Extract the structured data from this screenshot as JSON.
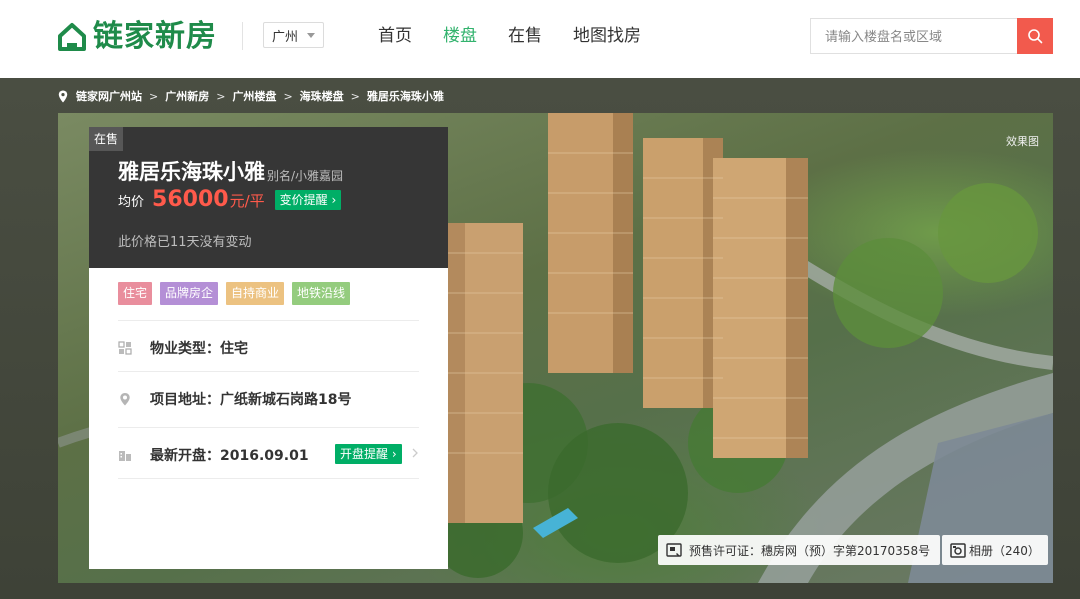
{
  "header": {
    "logo_text": "链家新房",
    "city": "广州",
    "nav": [
      {
        "label": "首页",
        "active": false
      },
      {
        "label": "楼盘",
        "active": true
      },
      {
        "label": "在售",
        "active": false
      },
      {
        "label": "地图找房",
        "active": false
      }
    ],
    "search": {
      "placeholder": "请输入楼盘名或区域",
      "value": ""
    },
    "accent": "#33b36e"
  },
  "breadcrumb": [
    "链家网广州站",
    "广州新房",
    "广州楼盘",
    "海珠楼盘",
    "雅居乐海珠小雅"
  ],
  "hero": {
    "effect_label": "效果图",
    "license": "预售许可证：穗房网（预）字第20170358号",
    "album": "相册（240）"
  },
  "project": {
    "status": "在售",
    "name": "雅居乐海珠小雅",
    "alias": "别名/小雅嘉园",
    "price_label": "均价",
    "price": "56000",
    "price_unit": "元/平",
    "price_alert": "变价提醒",
    "price_note": "此价格已11天没有变动",
    "tags": [
      "住宅",
      "品牌房企",
      "自持商业",
      "地铁沿线"
    ],
    "property_type": "物业类型：住宅",
    "address": "项目地址：广纸新城石岗路18号",
    "latest_open": "最新开盘：2016.09.01",
    "open_alert": "开盘提醒",
    "price_color": "#ff5a4b",
    "tag_colors": [
      "#e98e9d",
      "#b48fd6",
      "#ecc281",
      "#94cc7e"
    ]
  }
}
